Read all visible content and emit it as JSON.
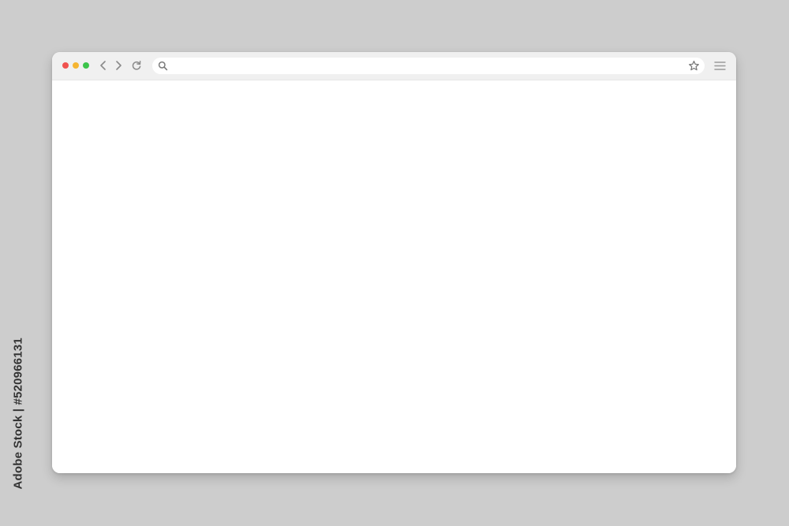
{
  "browser": {
    "window_controls": [
      {
        "name": "close",
        "color": "#f0524f"
      },
      {
        "name": "minimize",
        "color": "#f5b532"
      },
      {
        "name": "maximize",
        "color": "#3cc44b"
      }
    ],
    "nav": {
      "back_icon": "chevron-left-icon",
      "forward_icon": "chevron-right-icon",
      "reload_icon": "reload-icon"
    },
    "address_bar": {
      "search_icon": "search-icon",
      "value": "",
      "placeholder": "",
      "bookmark_icon": "star-icon"
    },
    "menu_icon": "hamburger-menu-icon"
  },
  "content": {
    "blank": true
  },
  "stock_badge": {
    "text": "Adobe Stock | #520966131"
  }
}
